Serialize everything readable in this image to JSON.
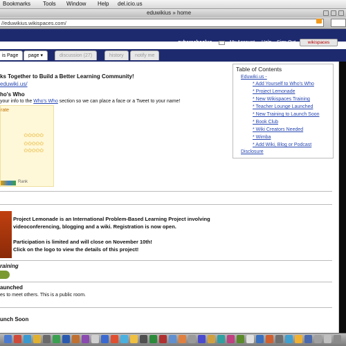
{
  "menubar": {
    "items": [
      "Bookmarks",
      "Tools",
      "Window",
      "Help",
      "del.icio.us"
    ]
  },
  "window": {
    "title": "eduwikius » home"
  },
  "address": {
    "value": "//eduwikius.wikispaces.com/"
  },
  "top_links": {
    "user": "cyberschoolus",
    "my_account": "My Account",
    "help": "Help",
    "sign_out": "Sign Out",
    "wikispaces": "wikispaces"
  },
  "tabs": [
    {
      "label": "is Page"
    },
    {
      "label": "page ▾"
    },
    {
      "label": "discussion (27)"
    },
    {
      "label": "history"
    },
    {
      "label": "notify me"
    }
  ],
  "main": {
    "heading": "ks Together to Build a Better Learning Community!",
    "heading_link": "eduwiki.us/",
    "whos_who_title": "ho's Who",
    "whos_who_text_pre": "your info to the ",
    "whos_who_link": "Who's Who",
    "whos_who_text_post": " section so we can place a face or a Tweet to your name!",
    "badge_label": "rate",
    "badge_footer": "Rank",
    "lemonade_line1": "Project Lemonade is an International Problem-Based Learning Project involving",
    "lemonade_line2": "videoconferencing, blogging and a wiki. Registration is now open.",
    "lemonade_line3": "Participation is limited and will close on November 10th!",
    "lemonade_line4": "Click on the logo to view the details of this project!",
    "training": "raining",
    "launched": "aunched",
    "launched_desc": "es to meet others. This is a public room.",
    "launch_soon": "unch Soon"
  },
  "toc": {
    "title": "Table of Contents",
    "items": [
      "Eduwiki.us -",
      "* Add Yourself to Who's Who",
      "* Project Lemonade",
      "* New Wikispaces Training",
      "* Teacher Lounge Launched",
      "* New Training to Launch Soon",
      "* Book Club",
      "* Wiki Creators Needed",
      "* Wimba",
      "* Add Wiki, Blog or Podcast",
      "Disclosure"
    ]
  },
  "colors": {
    "navy": "#1e2a6e",
    "link": "#2545b0"
  }
}
